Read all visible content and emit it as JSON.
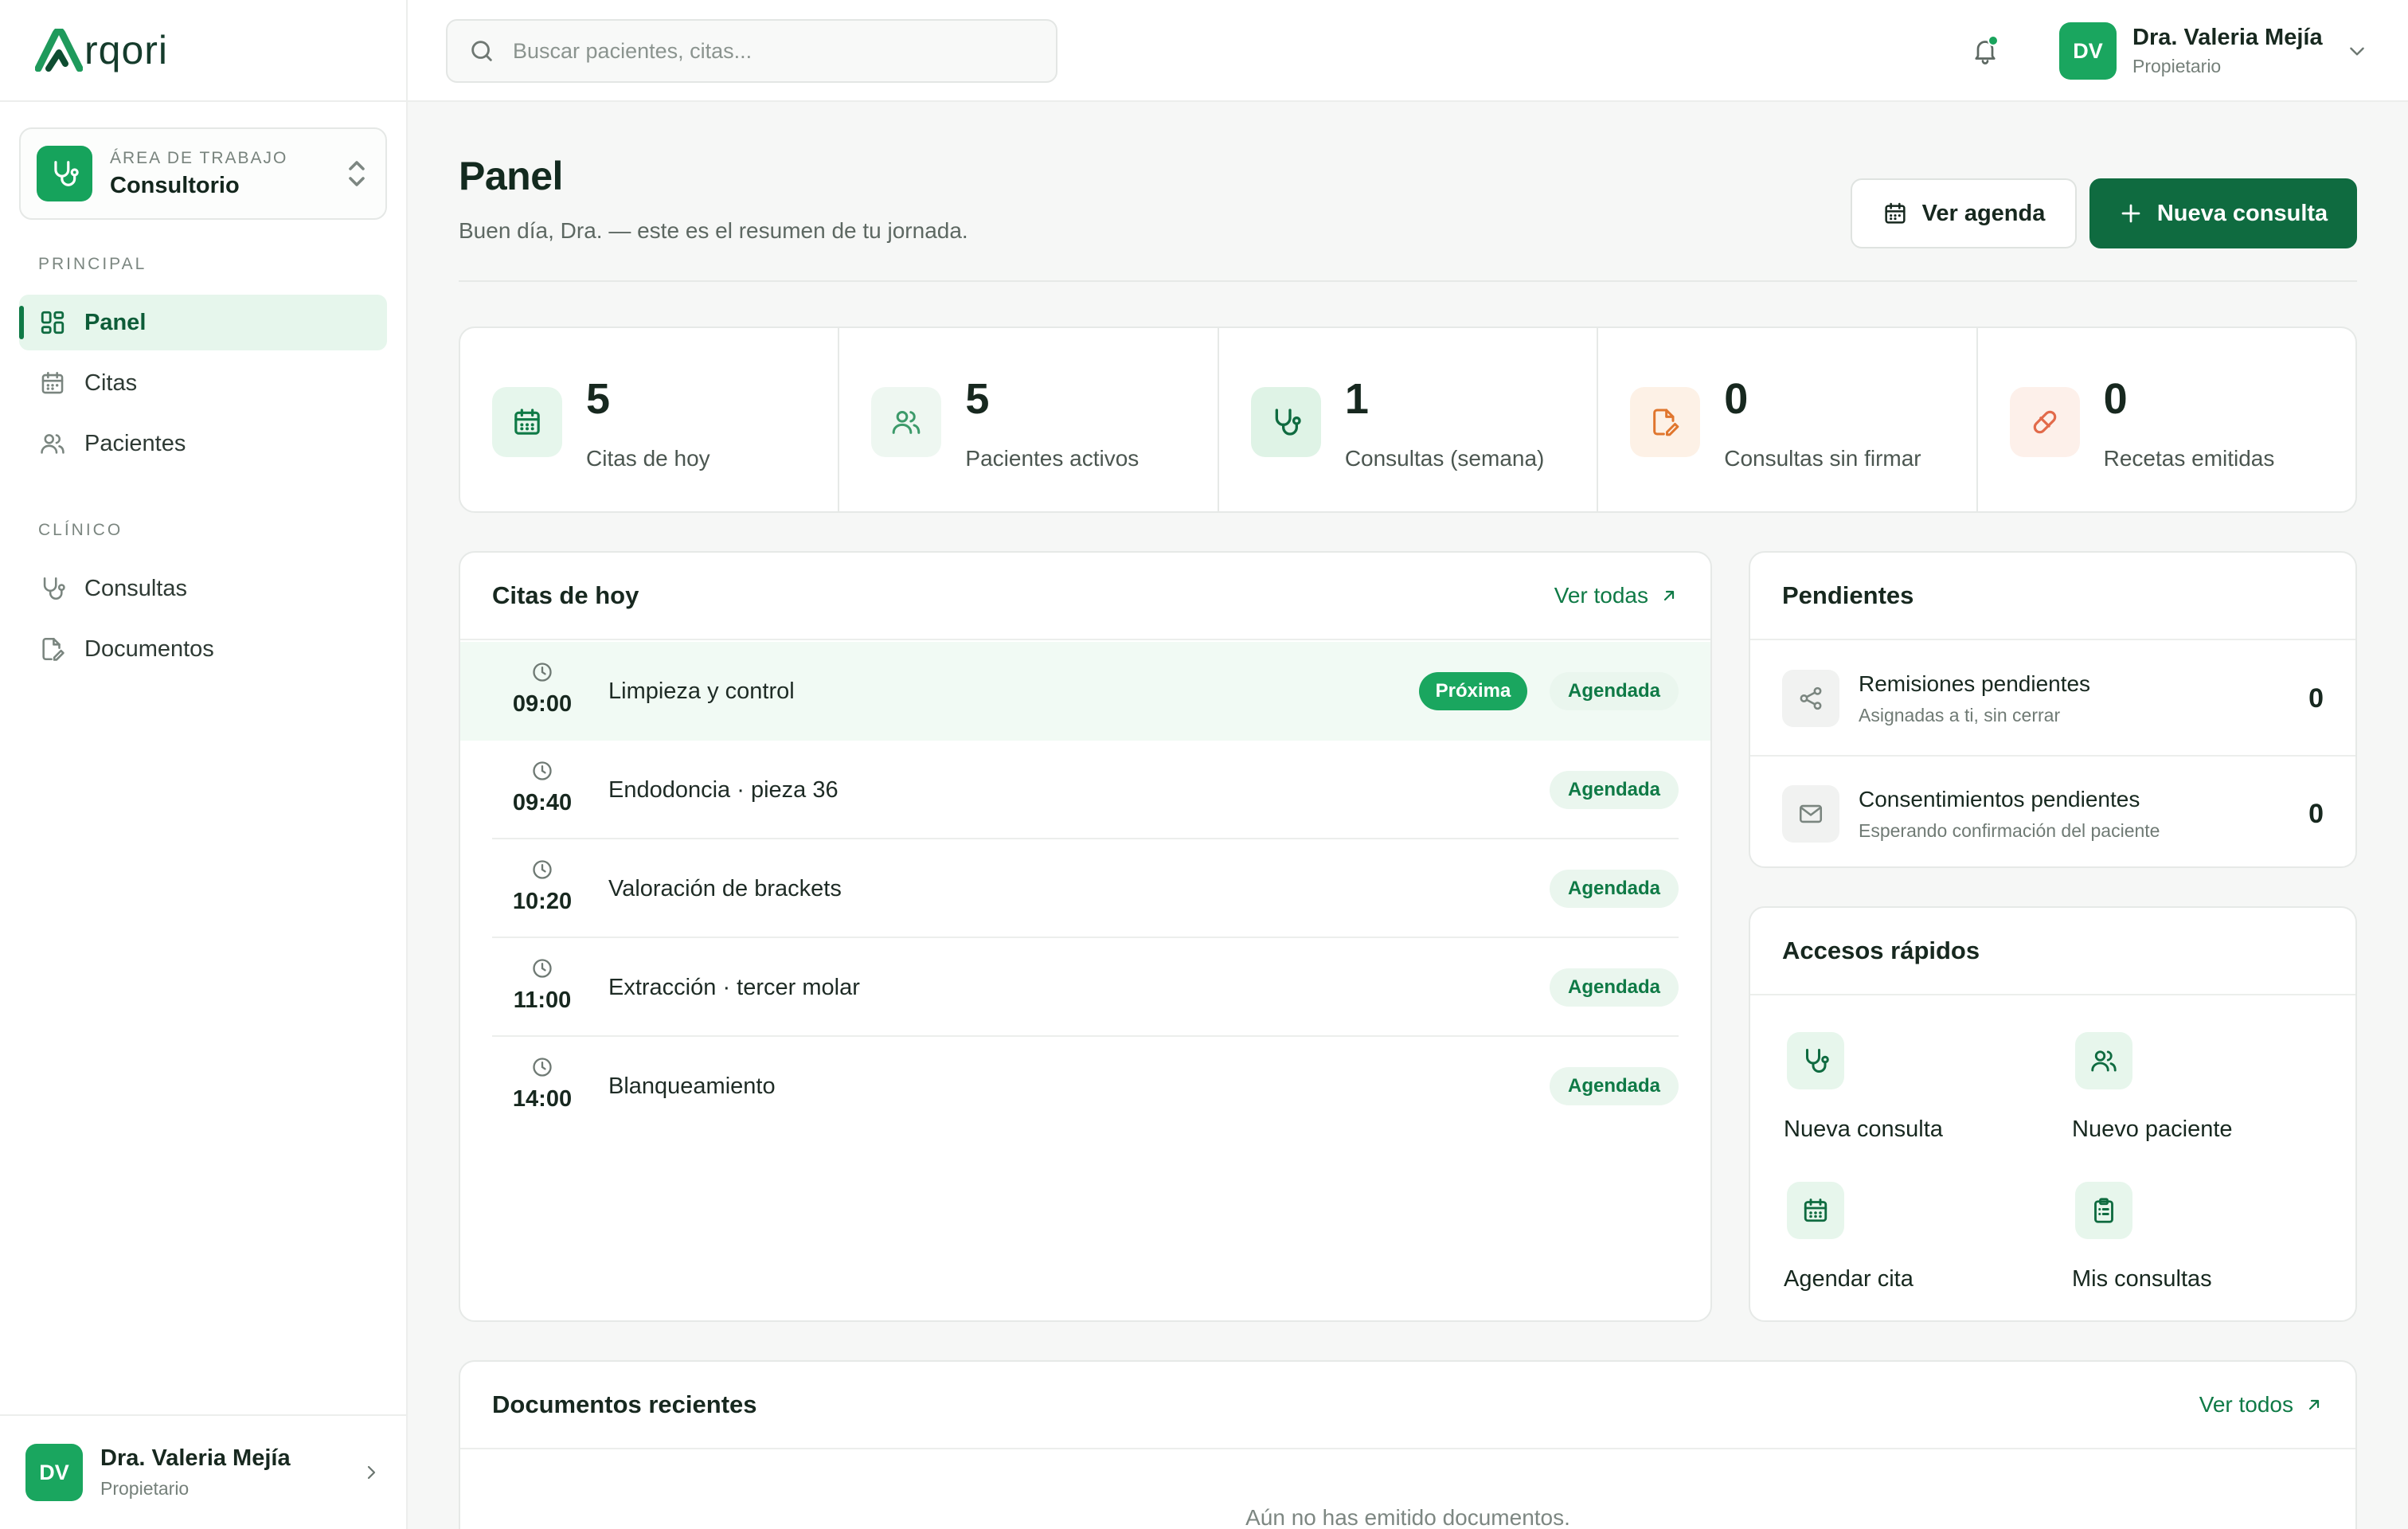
{
  "brand": {
    "logo_text": "rqori"
  },
  "workspace": {
    "kicker": "ÁREA DE TRABAJO",
    "name": "Consultorio"
  },
  "sidebar": {
    "section_main": "PRINCIPAL",
    "section_clinical": "CLÍNICO",
    "items": [
      {
        "label": "Panel",
        "icon": "dashboard-icon",
        "active": true
      },
      {
        "label": "Citas",
        "icon": "calendar-icon"
      },
      {
        "label": "Pacientes",
        "icon": "users-icon"
      },
      {
        "label": "Consultas",
        "icon": "stethoscope-icon"
      },
      {
        "label": "Documentos",
        "icon": "document-edit-icon"
      }
    ]
  },
  "user": {
    "initials": "DV",
    "name": "Dra. Valeria Mejía",
    "role": "Propietario"
  },
  "search": {
    "placeholder": "Buscar pacientes, citas..."
  },
  "page": {
    "title": "Panel",
    "subtitle": "Buen día, Dra. — este es el resumen de tu jornada.",
    "btn_agenda": "Ver agenda",
    "btn_new": "Nueva consulta"
  },
  "stats": [
    {
      "value": "5",
      "label": "Citas de hoy",
      "icon": "calendar-icon",
      "color": "#0f7a46"
    },
    {
      "value": "5",
      "label": "Pacientes activos",
      "icon": "users-icon",
      "color": "#3c9a6a"
    },
    {
      "value": "1",
      "label": "Consultas (semana)",
      "icon": "stethoscope-icon",
      "color": "#0f6b40"
    },
    {
      "value": "0",
      "label": "Consultas sin firmar",
      "icon": "document-edit-icon",
      "color": "#e0762e"
    },
    {
      "value": "0",
      "label": "Recetas emitidas",
      "icon": "pill-icon",
      "color": "#e26a4a"
    }
  ],
  "appointments": {
    "title": "Citas de hoy",
    "link": "Ver todas",
    "next_label": "Próxima",
    "rows": [
      {
        "time": "09:00",
        "title": "Limpieza y control",
        "status": "Agendada",
        "next": true
      },
      {
        "time": "09:40",
        "title": "Endodoncia · pieza 36",
        "status": "Agendada"
      },
      {
        "time": "10:20",
        "title": "Valoración de brackets",
        "status": "Agendada"
      },
      {
        "time": "11:00",
        "title": "Extracción · tercer molar",
        "status": "Agendada"
      },
      {
        "time": "14:00",
        "title": "Blanqueamiento",
        "status": "Agendada"
      }
    ]
  },
  "pending": {
    "title": "Pendientes",
    "items": [
      {
        "title": "Remisiones pendientes",
        "subtitle": "Asignadas a ti, sin cerrar",
        "count": "0",
        "icon": "share-icon"
      },
      {
        "title": "Consentimientos pendientes",
        "subtitle": "Esperando confirmación del paciente",
        "count": "0",
        "icon": "mail-icon"
      }
    ]
  },
  "quick": {
    "title": "Accesos rápidos",
    "items": [
      {
        "label": "Nueva consulta",
        "icon": "stethoscope-icon"
      },
      {
        "label": "Nuevo paciente",
        "icon": "users-icon"
      },
      {
        "label": "Agendar cita",
        "icon": "calendar-icon"
      },
      {
        "label": "Mis consultas",
        "icon": "clipboard-icon"
      }
    ]
  },
  "documents": {
    "title": "Documentos recientes",
    "link": "Ver todos",
    "empty": "Aún no has emitido documentos."
  },
  "colors": {
    "primary": "#0f6b40",
    "accent": "#1aa65f",
    "background": "#f6f7f6"
  }
}
